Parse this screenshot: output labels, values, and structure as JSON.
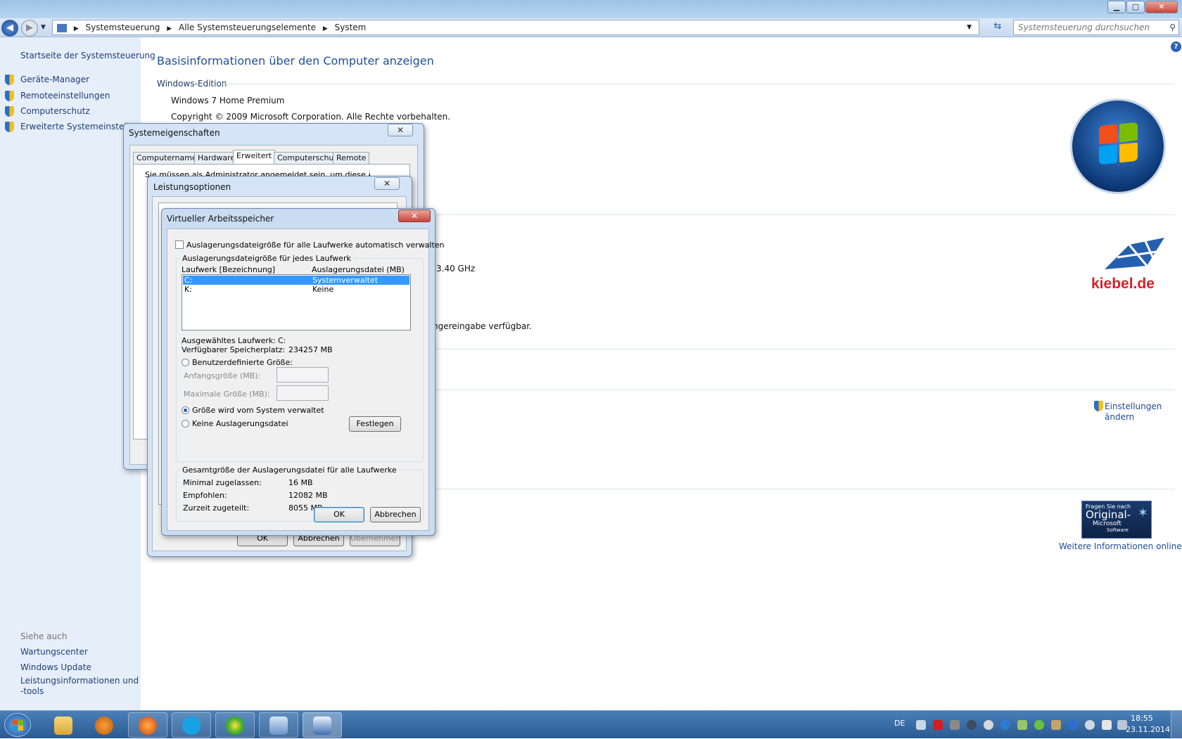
{
  "window": {
    "min_label": "▁",
    "max_label": "▢",
    "close_label": "✕"
  },
  "address": {
    "crumbs": [
      "Systemsteuerung",
      "Alle Systemsteuerungselemente",
      "System"
    ],
    "search_placeholder": "Systemsteuerung durchsuchen"
  },
  "sidebar": {
    "home": "Startseite der Systemsteuerung",
    "items": [
      "Geräte-Manager",
      "Remoteeinstellungen",
      "Computerschutz",
      "Erweiterte Systemeinstellungen"
    ],
    "see_also_title": "Siehe auch",
    "see_also": [
      "Wartungscenter",
      "Windows Update",
      "Leistungsinformationen und",
      "-tools"
    ]
  },
  "main": {
    "title": "Basisinformationen über den Computer anzeigen",
    "edition_section": "Windows-Edition",
    "edition": "Windows 7 Home Premium",
    "copyright": "Copyright © 2009 Microsoft Corporation. Alle Rechte vorbehalten.",
    "cpu_fragment": "3.40 GHz",
    "pen_fragment": "ngereingabe verfügbar.",
    "change_settings_1": "Einstellungen",
    "change_settings_2": "ändern",
    "oem_logo": "kiebel.de",
    "genuine_1": "Fragen Sie nach",
    "genuine_2": "Original-",
    "genuine_3": "Microsoft",
    "genuine_4": "Software",
    "more_info": "Weitere Informationen online..."
  },
  "sysprops": {
    "title": "Systemeigenschaften",
    "tabs": [
      "Computername",
      "Hardware",
      "Erweitert",
      "Computerschutz",
      "Remote"
    ],
    "note": "Sie müssen als Administrator angemeldet sein, um diese Änderungen"
  },
  "perf": {
    "title": "Leistungsoptionen",
    "ok": "OK",
    "cancel": "Abbrechen",
    "apply": "Übernehmen"
  },
  "vmem": {
    "title": "Virtueller Arbeitsspeicher",
    "auto_label": "Auslagerungsdateigröße für alle Laufwerke automatisch verwalten",
    "per_drive_group": "Auslagerungsdateigröße für jedes Laufwerk",
    "col_drive": "Laufwerk [Bezeichnung]",
    "col_pagefile": "Auslagerungsdatei (MB)",
    "drives": [
      {
        "drive": "C:",
        "pagefile": "Systemverwaltet"
      },
      {
        "drive": "K:",
        "pagefile": "Keine"
      }
    ],
    "selected_drive_label": "Ausgewähltes Laufwerk:",
    "selected_drive_value": "C:",
    "free_space_label": "Verfügbarer Speicherplatz:",
    "free_space_value": "234257 MB",
    "custom_size": "Benutzerdefinierte Größe:",
    "initial_size": "Anfangsgröße (MB):",
    "max_size": "Maximale Größe (MB):",
    "system_managed": "Größe wird vom System verwaltet",
    "no_pagefile": "Keine Auslagerungsdatei",
    "set_button": "Festlegen",
    "total_group": "Gesamtgröße der Auslagerungsdatei für alle Laufwerke",
    "min_label": "Minimal zugelassen:",
    "min_value": "16 MB",
    "rec_label": "Empfohlen:",
    "rec_value": "12082 MB",
    "cur_label": "Zurzeit zugeteilt:",
    "cur_value": "8055 MB",
    "ok": "OK",
    "cancel": "Abbrechen"
  },
  "taskbar": {
    "lang": "DE",
    "time": "18:55",
    "date": "23.11.2014"
  },
  "colors": {
    "accent": "#1f4e99",
    "selection": "#3399ff",
    "taskbar": "#2a5a92"
  }
}
